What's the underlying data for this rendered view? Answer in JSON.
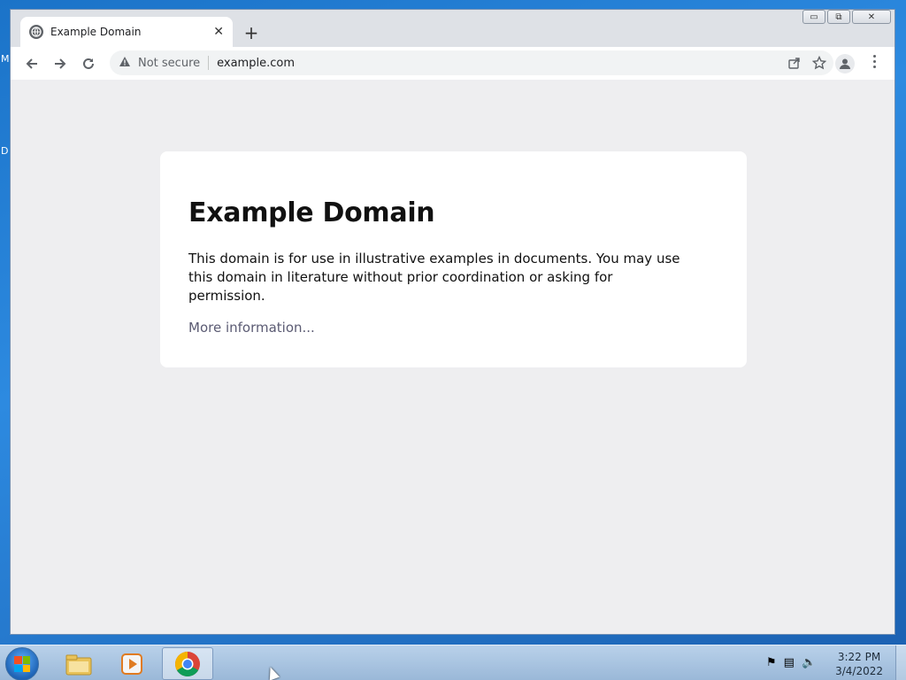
{
  "desktop": {
    "frag_top": "M",
    "frag_mid": "D"
  },
  "window_controls": {
    "minimize": "▭",
    "maximize": "⧉",
    "close": "✕"
  },
  "tab": {
    "title": "Example Domain",
    "favicon": "globe-icon",
    "close": "✕",
    "new_tab": "+"
  },
  "toolbar": {
    "back": "arrow-left-icon",
    "forward": "arrow-right-icon",
    "reload": "reload-icon",
    "security_label": "Not secure",
    "url": "example.com",
    "share": "share-icon",
    "bookmark": "star-icon",
    "profile": "profile-icon",
    "menu": "kebab-menu-icon"
  },
  "page": {
    "heading": "Example Domain",
    "body": "This domain is for use in illustrative examples in documents. You may use this domain in literature without prior coordination or asking for permission.",
    "link": "More information..."
  },
  "taskbar": {
    "items": [
      "file-explorer-icon",
      "media-player-icon",
      "chrome-icon"
    ],
    "time": "3:22 PM",
    "date": "3/4/2022"
  },
  "colors": {
    "link": "#5b5b73",
    "page_bg": "#eeeef0",
    "card_bg": "#ffffff"
  }
}
